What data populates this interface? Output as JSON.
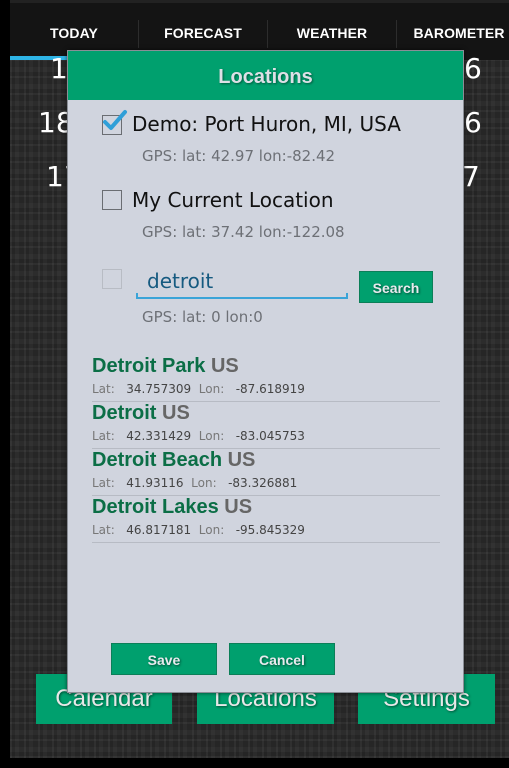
{
  "tabs": [
    {
      "label": "TODAY",
      "active": true
    },
    {
      "label": "FORECAST",
      "active": false
    },
    {
      "label": "WEATHER",
      "active": false
    },
    {
      "label": "BAROMETER",
      "active": false
    }
  ],
  "background": {
    "left_numbers": [
      "1",
      "18",
      "17"
    ],
    "right_numbers": [
      "6",
      "6",
      "7"
    ],
    "buttons": [
      "Calendar",
      "Locations",
      "Settings"
    ]
  },
  "dialog": {
    "title": "Locations",
    "locations": [
      {
        "label": "Demo: Port Huron, MI, USA",
        "gps": "GPS: lat: 42.97 lon:-82.42",
        "checked": true
      },
      {
        "label": "My Current Location",
        "gps": "GPS: lat: 37.42 lon:-122.08",
        "checked": false
      }
    ],
    "search": {
      "value": "detroit",
      "button_label": "Search",
      "gps": "GPS: lat: 0 lon:0",
      "checked": false
    },
    "results": [
      {
        "name": "Detroit Park",
        "country": "US",
        "lat_label": "Lat:",
        "lat": "34.757309",
        "lon_label": "Lon:",
        "lon": "-87.618919"
      },
      {
        "name": "Detroit",
        "country": "US",
        "lat_label": "Lat:",
        "lat": "42.331429",
        "lon_label": "Lon:",
        "lon": "-83.045753"
      },
      {
        "name": "Detroit Beach",
        "country": "US",
        "lat_label": "Lat:",
        "lat": "41.93116",
        "lon_label": "Lon:",
        "lon": "-83.326881"
      },
      {
        "name": "Detroit Lakes",
        "country": "US",
        "lat_label": "Lat:",
        "lat": "46.817181",
        "lon_label": "Lon:",
        "lon": "-95.845329"
      }
    ],
    "save_label": "Save",
    "cancel_label": "Cancel"
  },
  "colors": {
    "accent_green": "#00a06e",
    "tab_indicator": "#2eb4e6",
    "result_name": "#0b6e46"
  }
}
